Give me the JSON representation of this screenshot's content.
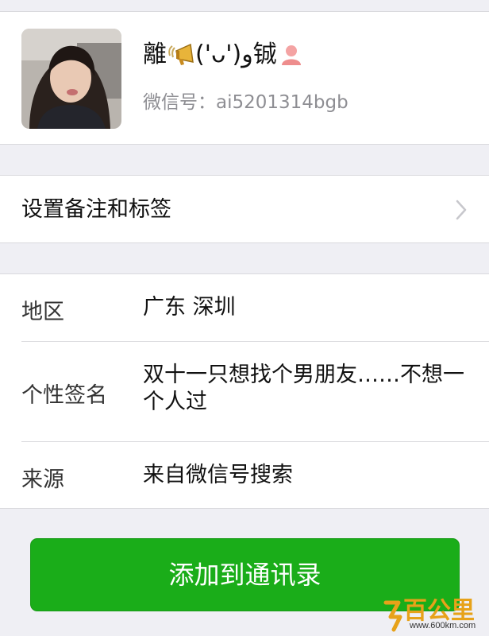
{
  "profile": {
    "name_prefix": "離",
    "name_kaomoji": "('ᴗ')و",
    "name_suffix": "铖",
    "wechat_id_label": "微信号：",
    "wechat_id": "ai5201314bgb",
    "icons": [
      "megaphone-icon",
      "person-icon"
    ]
  },
  "remark": {
    "label": "设置备注和标签",
    "icon": "chevron-right-icon"
  },
  "info": {
    "region_label": "地区",
    "region_value": "广东  深圳",
    "signature_label": "个性签名",
    "signature_value": "双十一只想找个男朋友……不想一个人过",
    "source_label": "来源",
    "source_value": "来自微信号搜索"
  },
  "actions": {
    "add_contact_label": "添加到通讯录"
  },
  "watermark": {
    "logo_text": "百公里",
    "url": "www.600km.com"
  },
  "colors": {
    "background": "#efeff4",
    "primary_button": "#1aad19",
    "secondary_text": "#8e8e93"
  }
}
